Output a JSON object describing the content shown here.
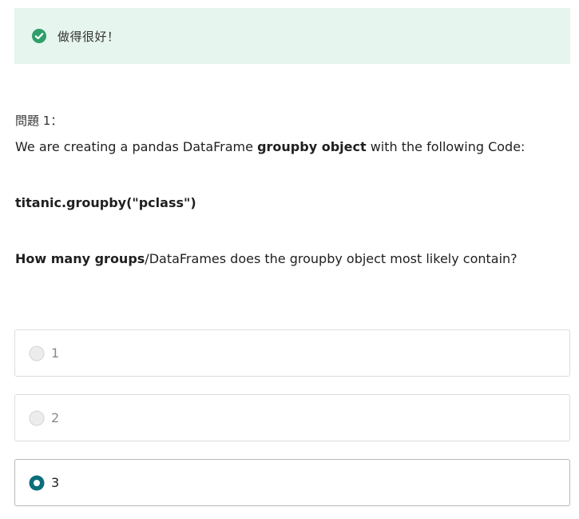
{
  "feedback": {
    "text": "做得很好！",
    "icon": "check-circle-icon",
    "color": "#2f9e6a"
  },
  "question": {
    "number": "問題 1：",
    "line1_pre": "We are creating  a pandas DataFrame ",
    "line1_bold": "groupby object",
    "line1_post": " with the following Code:",
    "code": "titanic.groupby(\"pclass\")",
    "line3_bold": "How many groups",
    "line3_post": "/DataFrames does the groupby object most likely contain?"
  },
  "options": [
    {
      "label": "1",
      "selected": false
    },
    {
      "label": "2",
      "selected": false
    },
    {
      "label": "3",
      "selected": true
    }
  ],
  "colors": {
    "selected_radio": "#0b6e7c",
    "banner_bg": "#e6f5ee"
  }
}
